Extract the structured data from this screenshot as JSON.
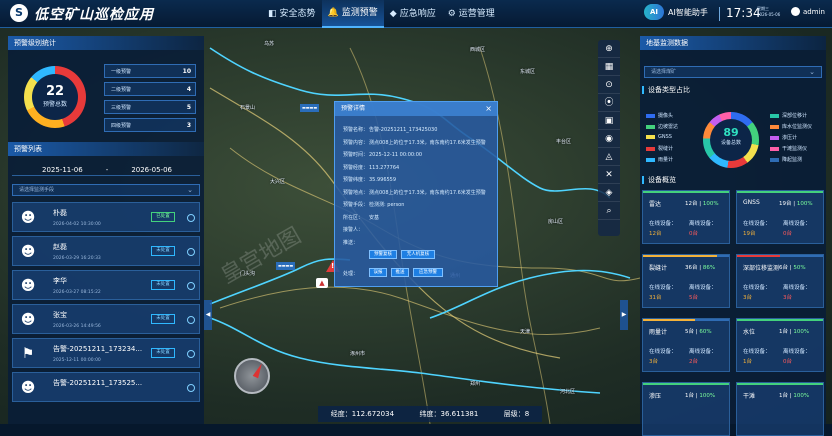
{
  "header": {
    "logo_glyph": "S",
    "title": "低空矿山巡检应用",
    "nav": [
      {
        "label": "安全态势",
        "icon": "◧"
      },
      {
        "label": "监测预警",
        "icon": "🔔"
      },
      {
        "label": "应急响应",
        "icon": "◆"
      },
      {
        "label": "运营管理",
        "icon": "⚙"
      }
    ],
    "ai_badge": "AI",
    "ai_label": "AI智能助手",
    "time": "17:34",
    "weekday": "星期三",
    "date": "2026-05-06",
    "user": "admin"
  },
  "left": {
    "stats_title": "预警级别统计",
    "total": "22",
    "total_label": "预警总数",
    "levels": [
      {
        "label": "一级预警",
        "count": "10"
      },
      {
        "label": "二级预警",
        "count": "4"
      },
      {
        "label": "三级预警",
        "count": "5"
      },
      {
        "label": "四级预警",
        "count": "3"
      }
    ],
    "list_title": "预警列表",
    "date_start": "2025-11-06",
    "date_sep": "-",
    "date_end": "2026-05-06",
    "method_placeholder": "请选择监测手段",
    "alerts": [
      {
        "name": "朴磊",
        "time": "2026-04-02 10:30:00",
        "status": "已处置",
        "ok": true
      },
      {
        "name": "赵磊",
        "time": "2026-03-29 16:20:33",
        "status": "未处置",
        "ok": false
      },
      {
        "name": "李华",
        "time": "2026-03-27 08:15:22",
        "status": "未处置",
        "ok": false
      },
      {
        "name": "张宝",
        "time": "2026-03-26 14:49:56",
        "status": "未处置",
        "ok": false
      },
      {
        "name": "告警-20251211_173234...",
        "time": "2025-12-11 00:00:00",
        "status": "未处置",
        "ok": false
      },
      {
        "name": "告警-20251211_173525...",
        "time": "",
        "status": "",
        "ok": false
      }
    ]
  },
  "right": {
    "title": "地基监测数据",
    "mine_placeholder": "请选择煤矿",
    "ratio_title": "设备类型占比",
    "device_total": "89",
    "device_total_label": "设备总数",
    "legend_left": [
      {
        "label": "摄像头",
        "color": "#2f6cf0"
      },
      {
        "label": "边坡雷达",
        "color": "#43d17d"
      },
      {
        "label": "GNSS",
        "color": "#f4e04d"
      },
      {
        "label": "裂缝计",
        "color": "#e83a3a"
      },
      {
        "label": "雨量计",
        "color": "#2fb8ff"
      }
    ],
    "legend_right": [
      {
        "label": "深部位移计",
        "color": "#28c7a8"
      },
      {
        "label": "库水位监测仪",
        "color": "#ff8a3a"
      },
      {
        "label": "渗压计",
        "color": "#c45ef0"
      },
      {
        "label": "干滩监测仪",
        "color": "#ff5fa8"
      },
      {
        "label": "降起监测",
        "color": "#2f6cb4"
      }
    ],
    "overview_title": "设备概览",
    "online_label": "在线设备：",
    "offline_label": "离线设备：",
    "cards": [
      {
        "name": "雷达",
        "count": "12台",
        "rate": "100%",
        "ratio": 1.0,
        "online": "12台",
        "offline": "0台"
      },
      {
        "name": "GNSS",
        "count": "19台",
        "rate": "100%",
        "ratio": 1.0,
        "online": "19台",
        "offline": "0台"
      },
      {
        "name": "裂缝计",
        "count": "36台",
        "rate": "86%",
        "ratio": 0.86,
        "online": "31台",
        "offline": "5台"
      },
      {
        "name": "深部位移监测",
        "count": "6台",
        "rate": "50%",
        "ratio": 0.5,
        "online": "3台",
        "offline": "3台"
      },
      {
        "name": "雨量计",
        "count": "5台",
        "rate": "60%",
        "ratio": 0.6,
        "online": "3台",
        "offline": "2台"
      },
      {
        "name": "水位",
        "count": "1台",
        "rate": "100%",
        "ratio": 1.0,
        "online": "1台",
        "offline": "0台"
      },
      {
        "name": "渗压",
        "count": "1台",
        "rate": "100%",
        "ratio": 1.0,
        "online": "",
        "offline": ""
      },
      {
        "name": "干滩",
        "count": "1台",
        "rate": "100%",
        "ratio": 1.0,
        "online": "",
        "offline": ""
      }
    ]
  },
  "tools": [
    "⊕",
    "▦",
    "⊙",
    "⦿",
    "▣",
    "◉",
    "◬",
    "✕",
    "◈",
    "⌕"
  ],
  "popup": {
    "title": "预警详情",
    "close": "×",
    "rows": [
      {
        "k": "预警名称：",
        "v": "告警-20251211_173425030"
      },
      {
        "k": "预警内容：",
        "v": "测点008上的位于17.3米，南东南约17.6米发生预警"
      },
      {
        "k": "预警时间：",
        "v": "2025-12-11 00:00:00"
      },
      {
        "k": "预警经度：",
        "v": "113.277764"
      },
      {
        "k": "预警纬度：",
        "v": "35.996559"
      },
      {
        "k": "预警地点：",
        "v": "测点008上的位于17.3米，南东南约17.6米发生预警"
      },
      {
        "k": "预警手段：",
        "v": "检测测: person"
      },
      {
        "k": "所在区：",
        "v": "安基"
      },
      {
        "k": "接警人：",
        "v": ""
      },
      {
        "k": "推送：",
        "v": ""
      }
    ],
    "btn_a": "预警复核",
    "btn_b": "无人机复核",
    "op_label": "处理：",
    "btn_c": "误报",
    "btn_d": "推送",
    "btn_e": "应急预警"
  },
  "map": {
    "labels": [
      "乌苏",
      "西城区",
      "东城区",
      "石景山",
      "丰台区",
      "大兴区",
      "房山区",
      "通州",
      "门头沟",
      "涿州市",
      "天津",
      "郑州",
      "河北区"
    ],
    "watermark": "皇宫地图"
  },
  "coords": {
    "lon_label": "经度：",
    "lon": "112.672034",
    "lat_label": "纬度：",
    "lat": "36.611381",
    "level_label": "层级：",
    "level": "8"
  }
}
